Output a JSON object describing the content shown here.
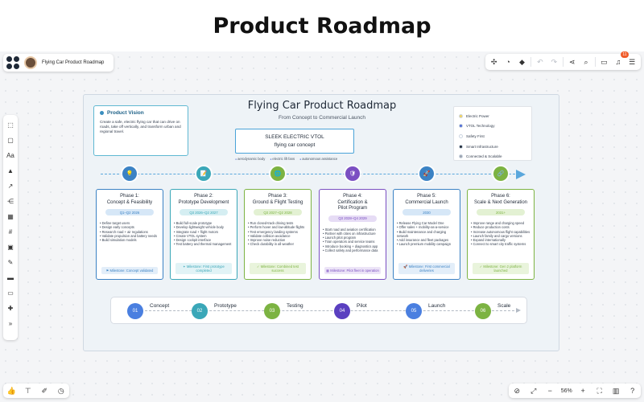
{
  "page_title": "Product Roadmap",
  "app": {
    "board_title": "Flying Car Product Roadmap",
    "notification_count": "11",
    "zoom_level": "56%"
  },
  "board": {
    "title": "Flying Car Product Roadmap",
    "subtitle": "From Concept to Commercial Launch",
    "vision": {
      "title": "Product Vision",
      "text": "Create a safe, electric flying car that can drive on roads, take off vertically, and transform urban and regional travel."
    },
    "concept": {
      "name": "SLEEK ELECTRIC VTOL",
      "description": "flying car concept",
      "tags": [
        "aerodynamic body",
        "electric lift fans",
        "autonomous assistance"
      ]
    },
    "legend": [
      {
        "label": "Electric Power",
        "color": "#f4d35e"
      },
      {
        "label": "VTOL Technology",
        "color": "#4f6bd6"
      },
      {
        "label": "Safety First",
        "color": "#ffffff"
      },
      {
        "label": "Smart Infrastructure",
        "color": "#1f2937"
      },
      {
        "label": "Connected & Scalable",
        "color": "#9ca3af"
      }
    ],
    "phases": [
      {
        "title_line1": "Phase 1:",
        "title_line2": "Concept & Feasibility",
        "date": "Q1–Q2 2026",
        "items": [
          "Define target users",
          "Design early concepts",
          "Research road + air regulations",
          "Validate propulsion and battery needs",
          "Build simulation models"
        ],
        "milestone": "⚑ Milestone: Concept validated",
        "color": "#3b82c4",
        "badge_bg": "#d6e7f7",
        "milestone_bg": "#e3eef9",
        "icon": "💡"
      },
      {
        "title_line1": "Phase 2:",
        "title_line2": "Prototype Development",
        "date": "Q3 2026–Q2 2027",
        "items": [
          "Build full-scale prototype",
          "Develop lightweight vehicle body",
          "Integrate road + flight motors",
          "Create VTOL system",
          "Design cockpit interface",
          "Test battery and thermal management"
        ],
        "milestone": "✦ Milestone: First prototype completed",
        "color": "#3aa7b8",
        "badge_bg": "#d5eef2",
        "milestone_bg": "#e1f3f6",
        "icon": "📝"
      },
      {
        "title_line1": "Phase 3:",
        "title_line2": "Ground & Flight Testing",
        "date": "Q3 2027–Q2 2028",
        "items": [
          "Run closed-track driving tests",
          "Perform hover and low-altitude flights",
          "Test emergency landing systems",
          "Validate collision avoidance",
          "Improve noise reduction",
          "Check durability in all weather"
        ],
        "milestone": "✓ Milestone: Combined test success",
        "color": "#7cb342",
        "badge_bg": "#e3f1d3",
        "milestone_bg": "#e9f4dc",
        "icon": "🌐"
      },
      {
        "title_line1": "Phase 4:",
        "title_line2": "Certification &",
        "title_line3": "Pilot Program",
        "date": "Q3 2028–Q4 2029",
        "items": [
          "Start road and aviation certification",
          "Partner with cities on infrastructure",
          "Launch pilot program",
          "Train operators and service teams",
          "Introduce booking + diagnostics app",
          "Collect safety and performance data"
        ],
        "milestone": "▦ Milestone: Pilot fleet in operation",
        "color": "#7b4fc2",
        "badge_bg": "#e6dcf5",
        "milestone_bg": "#ece4f7",
        "icon": "🛡"
      },
      {
        "title_line1": "Phase 5:",
        "title_line2": "Commercial Launch",
        "date": "2030",
        "items": [
          "Release Flying Car Model One",
          "Offer sales + mobility-as-a-service",
          "Build maintenance and charging network",
          "Add insurance and fleet packages",
          "Launch premium mobility campaign"
        ],
        "milestone": "🚀 Milestone: First commercial deliveries",
        "color": "#3b82c4",
        "badge_bg": "#d6e7f7",
        "milestone_bg": "#e3eef9",
        "icon": "🚀"
      },
      {
        "title_line1": "Phase 6:",
        "title_line2": "Scale & Next Generation",
        "date": "2031+",
        "items": [
          "Improve range and charging speed",
          "Reduce production costs",
          "Increase autonomous flight capabilities",
          "Launch family and cargo versions",
          "Expand internationally",
          "Connect to smart city traffic systems"
        ],
        "milestone": "✓ Milestone: Gen 2 platform launched",
        "color": "#7cb342",
        "badge_bg": "#e3f1d3",
        "milestone_bg": "#e9f4dc",
        "icon": "🔗"
      }
    ],
    "steps": [
      {
        "num": "01",
        "label": "Concept",
        "color": "#4a7fe0"
      },
      {
        "num": "02",
        "label": "Prototype",
        "color": "#3aa7b8"
      },
      {
        "num": "03",
        "label": "Testing",
        "color": "#7cb342"
      },
      {
        "num": "04",
        "label": "Pilot",
        "color": "#5a3fc0"
      },
      {
        "num": "05",
        "label": "Launch",
        "color": "#4a7fe0"
      },
      {
        "num": "06",
        "label": "Scale",
        "color": "#7cb342"
      }
    ]
  }
}
